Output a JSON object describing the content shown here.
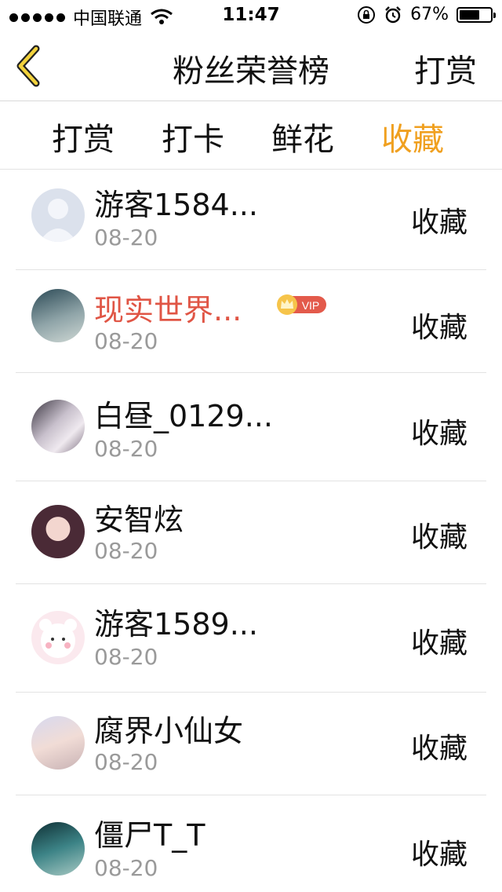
{
  "status_bar": {
    "carrier": "中国联通",
    "time": "11:47",
    "battery": "67%",
    "battery_level": 0.67
  },
  "nav": {
    "title": "粉丝荣誉榜",
    "action_label": "打赏",
    "back_icon": "chevron-left-icon"
  },
  "tabs": [
    {
      "label": "打赏",
      "active": false
    },
    {
      "label": "打卡",
      "active": false
    },
    {
      "label": "鲜花",
      "active": false
    },
    {
      "label": "收藏",
      "active": true
    }
  ],
  "list": [
    {
      "name": "游客1584...",
      "date": "08-20",
      "action": "收藏",
      "vip": false
    },
    {
      "name": "现实世界...",
      "date": "08-20",
      "action": "收藏",
      "vip": true,
      "badge": "VIP"
    },
    {
      "name": "白昼_0129...",
      "date": "08-20",
      "action": "收藏",
      "vip": false
    },
    {
      "name": "安智炫",
      "date": "08-20",
      "action": "收藏",
      "vip": false
    },
    {
      "name": "游客1589...",
      "date": "08-20",
      "action": "收藏",
      "vip": false
    },
    {
      "name": "腐界小仙女",
      "date": "08-20",
      "action": "收藏",
      "vip": false
    },
    {
      "name": "僵尸T_T",
      "date": "08-20",
      "action": "收藏",
      "vip": false
    }
  ],
  "colors": {
    "accent": "#f0a020",
    "vip_name": "#e05545",
    "date": "#9a9a9a"
  }
}
